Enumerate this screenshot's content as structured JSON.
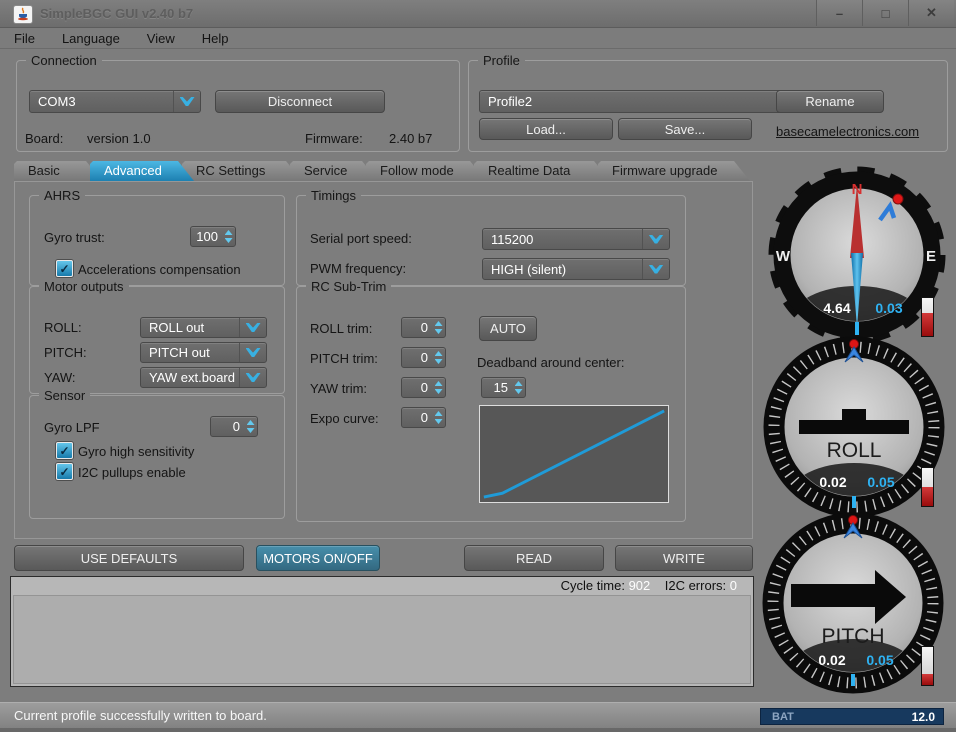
{
  "window": {
    "title": "SimpleBGC GUI v2.40 b7",
    "minimize": "–",
    "maximize": "□",
    "close": "✕"
  },
  "menu": {
    "file": "File",
    "language": "Language",
    "view": "View",
    "help": "Help"
  },
  "connection": {
    "title": "Connection",
    "port": "COM3",
    "disconnect": "Disconnect",
    "board_label": "Board:",
    "board_value": "version 1.0",
    "firmware_label": "Firmware:",
    "firmware_value": "2.40 b7"
  },
  "profile": {
    "title": "Profile",
    "name": "Profile2",
    "rename": "Rename",
    "load": "Load...",
    "save": "Save...",
    "website": "basecamelectronics.com"
  },
  "tabs": [
    "Basic",
    "Advanced",
    "RC Settings",
    "Service",
    "Follow mode",
    "Realtime Data",
    "Firmware upgrade"
  ],
  "selected_tab": "Advanced",
  "ahrs": {
    "title": "AHRS",
    "gyro_trust_label": "Gyro trust:",
    "gyro_trust": "100",
    "accel_label": "Accelerations compensation",
    "accel_checked": true
  },
  "motor_outputs": {
    "title": "Motor outputs",
    "roll_label": "ROLL:",
    "roll": "ROLL out",
    "pitch_label": "PITCH:",
    "pitch": "PITCH out",
    "yaw_label": "YAW:",
    "yaw": "YAW ext.board"
  },
  "sensor": {
    "title": "Sensor",
    "gyro_lpf_label": "Gyro LPF",
    "gyro_lpf": "0",
    "high_sens_label": "Gyro high sensitivity",
    "high_sens_checked": true,
    "i2c_pullups_label": "I2C pullups enable",
    "i2c_pullups_checked": true
  },
  "timings": {
    "title": "Timings",
    "serial_label": "Serial port speed:",
    "serial": "115200",
    "pwm_label": "PWM frequency:",
    "pwm": "HIGH (silent)"
  },
  "rc_subtrim": {
    "title": "RC Sub-Trim",
    "roll_label": "ROLL trim:",
    "roll": "0",
    "pitch_label": "PITCH trim:",
    "pitch": "0",
    "yaw_label": "YAW trim:",
    "yaw": "0",
    "expo_label": "Expo curve:",
    "expo": "0",
    "auto": "AUTO",
    "deadband_label": "Deadband around center:",
    "deadband": "15"
  },
  "actions": {
    "use_defaults": "USE DEFAULTS",
    "motors": "MOTORS ON/OFF",
    "read": "READ",
    "write": "WRITE"
  },
  "status_panel": {
    "cycle_label": "Cycle time:",
    "cycle": "902",
    "i2c_label": "I2C errors:",
    "i2c": "0"
  },
  "gauges": {
    "yaw": {
      "n": "N",
      "w": "W",
      "e": "E",
      "angle": "4.64",
      "rc": "0.03"
    },
    "roll": {
      "name": "ROLL",
      "angle": "0.02",
      "rc": "0.05"
    },
    "pitch": {
      "name": "PITCH",
      "angle": "0.02",
      "rc": "0.05"
    }
  },
  "statusbar": {
    "message": "Current profile successfully written to board.",
    "bat_label": "BAT",
    "bat_value": "12.0"
  },
  "glyphs": {
    "check": "✓"
  },
  "colors": {
    "accent_cyan": "#35aede",
    "tab_selected": "#2a95c4",
    "motors_button": "#3b7e98",
    "value_cyan": "#2eb2f2",
    "bat_bg": "#17395e",
    "needle_red": "#b93030",
    "curve": "#1f9bd8"
  }
}
